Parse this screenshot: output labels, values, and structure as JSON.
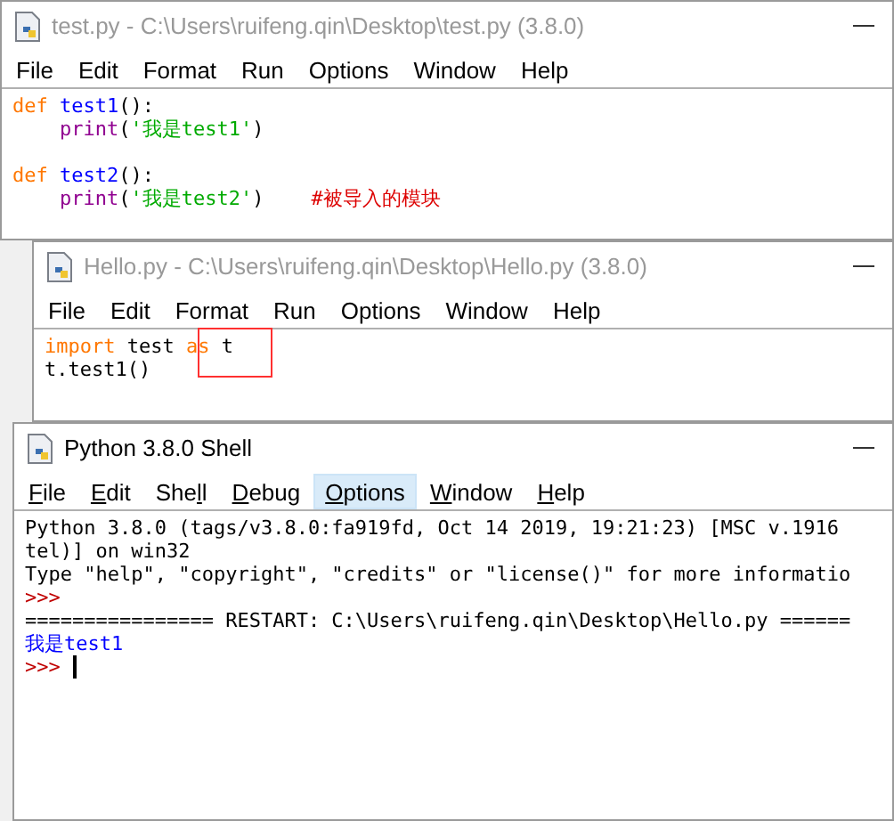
{
  "windows": [
    {
      "title": "test.py - C:\\Users\\ruifeng.qin\\Desktop\\test.py (3.8.0)",
      "active": false,
      "menu": [
        {
          "parts": [
            {
              "text": "File"
            }
          ]
        },
        {
          "parts": [
            {
              "text": "Edit"
            }
          ]
        },
        {
          "parts": [
            {
              "text": "Format"
            }
          ]
        },
        {
          "parts": [
            {
              "text": "Run"
            }
          ]
        },
        {
          "parts": [
            {
              "text": "Options"
            }
          ]
        },
        {
          "parts": [
            {
              "text": "Window"
            }
          ]
        },
        {
          "parts": [
            {
              "text": "Help"
            }
          ]
        }
      ],
      "blocks": [
        {
          "lines": [
            [
              {
                "text": "def",
                "kind": "keyword"
              },
              {
                "text": " test1",
                "kind": "definition"
              },
              {
                "text": "():",
                "kind": "plain"
              }
            ],
            [
              {
                "text": "    print",
                "kind": "builtin"
              },
              {
                "text": "(",
                "kind": "plain"
              },
              {
                "text": "'我是test1'",
                "kind": "string"
              },
              {
                "text": ")",
                "kind": "plain"
              }
            ]
          ]
        },
        {
          "lines": [
            [
              {
                "text": "def",
                "kind": "keyword"
              },
              {
                "text": " test2",
                "kind": "definition"
              },
              {
                "text": "():",
                "kind": "plain"
              }
            ],
            [
              {
                "text": "    print",
                "kind": "builtin"
              },
              {
                "text": "(",
                "kind": "plain"
              },
              {
                "text": "'我是test2'",
                "kind": "string"
              },
              {
                "text": ")    ",
                "kind": "plain"
              },
              {
                "text": "#被导入的模块",
                "kind": "comment"
              }
            ]
          ]
        }
      ]
    },
    {
      "title": "Hello.py - C:\\Users\\ruifeng.qin\\Desktop\\Hello.py (3.8.0)",
      "active": false,
      "menu": [
        {
          "parts": [
            {
              "text": "File"
            }
          ]
        },
        {
          "parts": [
            {
              "text": "Edit"
            }
          ]
        },
        {
          "parts": [
            {
              "text": "Format"
            }
          ]
        },
        {
          "parts": [
            {
              "text": "Run"
            }
          ]
        },
        {
          "parts": [
            {
              "text": "Options"
            }
          ]
        },
        {
          "parts": [
            {
              "text": "Window"
            }
          ]
        },
        {
          "parts": [
            {
              "text": "Help"
            }
          ]
        }
      ],
      "blocks": [
        {
          "lines": [
            [
              {
                "text": "import",
                "kind": "keyword"
              },
              {
                "text": " test ",
                "kind": "plain"
              },
              {
                "text": "as",
                "kind": "keyword"
              },
              {
                "text": " t",
                "kind": "plain"
              }
            ],
            [
              {
                "text": "t.test1()",
                "kind": "plain"
              }
            ]
          ]
        }
      ]
    },
    {
      "title": "Python 3.8.0 Shell",
      "active": true,
      "menu": [
        {
          "parts": [
            {
              "text": "F",
              "underlined": true
            },
            {
              "text": "ile",
              "underlined": false
            }
          ],
          "selected": false
        },
        {
          "parts": [
            {
              "text": "E",
              "underlined": true
            },
            {
              "text": "dit",
              "underlined": false
            }
          ],
          "selected": false
        },
        {
          "parts": [
            {
              "text": "She",
              "underlined": false
            },
            {
              "text": "l",
              "underlined": true
            },
            {
              "text": "l",
              "underlined": false
            }
          ],
          "selected": false
        },
        {
          "parts": [
            {
              "text": "D",
              "underlined": true
            },
            {
              "text": "ebug",
              "underlined": false
            }
          ],
          "selected": false
        },
        {
          "parts": [
            {
              "text": "O",
              "underlined": true
            },
            {
              "text": "ptions",
              "underlined": false
            }
          ],
          "selected": true
        },
        {
          "parts": [
            {
              "text": "W",
              "underlined": true
            },
            {
              "text": "indow",
              "underlined": false
            }
          ],
          "selected": false
        },
        {
          "parts": [
            {
              "text": "H",
              "underlined": true
            },
            {
              "text": "elp",
              "underlined": false
            }
          ],
          "selected": false
        }
      ],
      "blocks": [
        {
          "lines": [
            [
              {
                "text": "Python 3.8.0 (tags/v3.8.0:fa919fd, Oct 14 2019, 19:21:23) [MSC v.1916",
                "kind": "plain"
              }
            ],
            [
              {
                "text": "tel)] on win32",
                "kind": "plain"
              }
            ],
            [
              {
                "text": "Type \"help\", \"copyright\", \"credits\" or \"license()\" for more informatio",
                "kind": "plain"
              }
            ],
            [
              {
                "text": ">>>",
                "kind": "prompt"
              }
            ],
            [
              {
                "text": "================ RESTART: C:\\Users\\ruifeng.qin\\Desktop\\Hello.py ======",
                "kind": "plain"
              }
            ],
            [
              {
                "text": "我是test1",
                "kind": "stdout"
              }
            ],
            [
              {
                "text": ">>> ",
                "kind": "prompt"
              },
              {
                "kind": "cursor"
              }
            ]
          ]
        }
      ]
    }
  ]
}
